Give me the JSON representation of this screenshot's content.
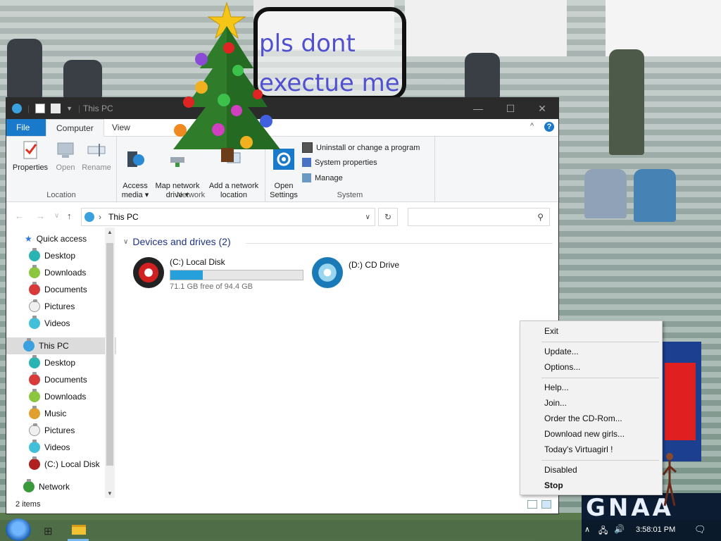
{
  "desktop": {
    "speech_text": "pls dont\nexectue me",
    "banner_text": "GNAA"
  },
  "window": {
    "title": "This PC",
    "tabs": {
      "file": "File",
      "computer": "Computer",
      "view": "View"
    },
    "ribbon": {
      "location": {
        "label": "Location",
        "properties": "Properties",
        "open": "Open",
        "rename": "Rename"
      },
      "network": {
        "label": "Network",
        "access_media": "Access\nmedia ▾",
        "map_drive": "Map network\ndrive ▾",
        "add_location": "Add a network\nlocation"
      },
      "system": {
        "label": "System",
        "open_settings": "Open\nSettings",
        "uninstall": "Uninstall or change a program",
        "system_properties": "System properties",
        "manage": "Manage"
      }
    },
    "address": {
      "path": "This PC",
      "search_placeholder": ""
    },
    "nav": {
      "quick_access": "Quick access",
      "quick_items": [
        "Desktop",
        "Downloads",
        "Documents",
        "Pictures",
        "Videos"
      ],
      "this_pc": "This PC",
      "pc_items": [
        "Desktop",
        "Documents",
        "Downloads",
        "Music",
        "Pictures",
        "Videos",
        "(C:) Local Disk"
      ],
      "network": "Network"
    },
    "content": {
      "section_title": "Devices and drives (2)",
      "drives": [
        {
          "name": "(C:) Local Disk",
          "free_text": "71.1 GB free of 94.4 GB",
          "used_fraction": 0.247
        },
        {
          "name": "(D:) CD Drive"
        }
      ]
    },
    "status": {
      "items": "2 items"
    }
  },
  "context_menu": {
    "items": [
      {
        "label": "Exit"
      },
      {
        "label": "Update..."
      },
      {
        "label": "Options..."
      },
      {
        "label": "Help..."
      },
      {
        "label": "Join..."
      },
      {
        "label": "Order the CD-Rom..."
      },
      {
        "label": "Download new girls..."
      },
      {
        "label": "Today's Virtuagirl !"
      },
      {
        "label": "Disabled"
      },
      {
        "label": "Stop"
      }
    ]
  },
  "taskbar": {
    "clock": "3:58:01 PM"
  },
  "colors": {
    "accent": "#1979ca",
    "drive_fill": "#26a0da",
    "title_bar": "#2b2b2b"
  }
}
